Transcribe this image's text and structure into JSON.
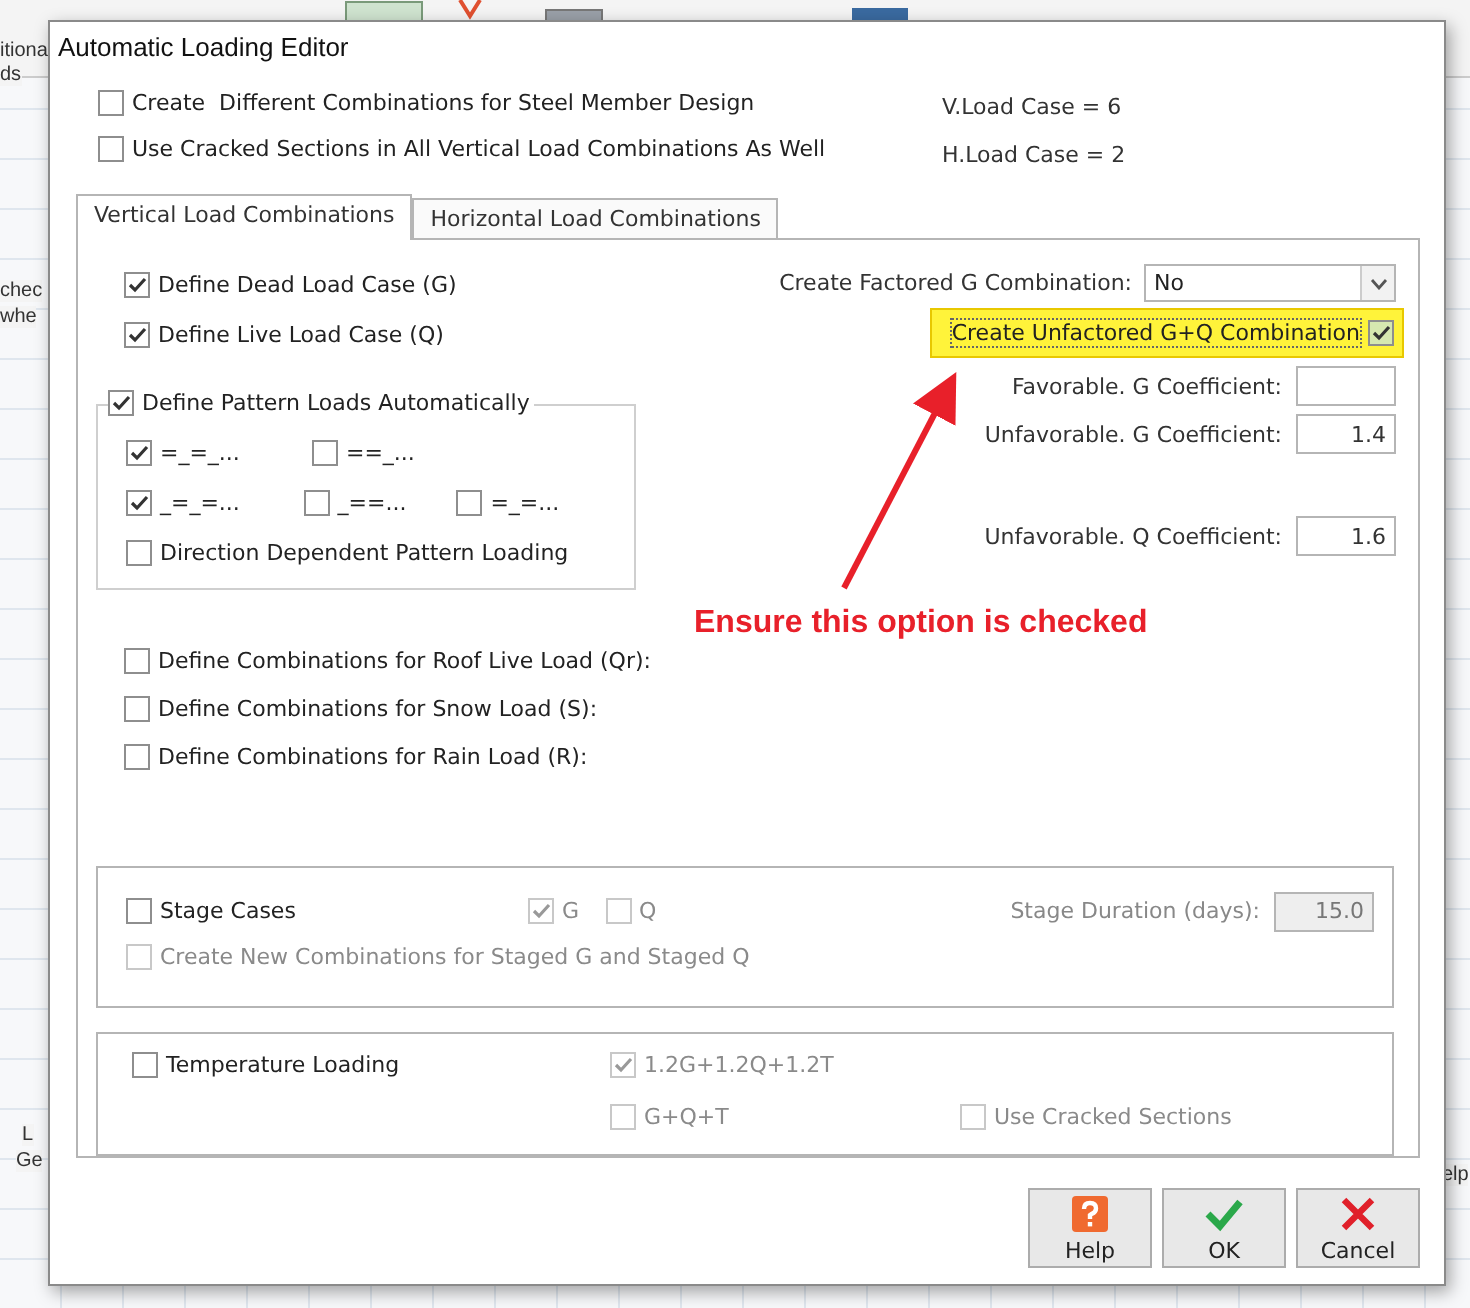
{
  "background": {
    "fragments": [
      "itiona",
      "ds",
      "chec",
      "whe",
      "L",
      "Ge",
      "elp"
    ]
  },
  "window": {
    "title": "Automatic Loading Editor"
  },
  "options": [
    {
      "label": "Create  Different Combinations for Steel Member Design",
      "checked": false
    },
    {
      "label": "Use Cracked Sections in All Vertical Load Combinations As Well",
      "checked": false
    }
  ],
  "load_case_counts": [
    "V.Load Case = 6",
    "H.Load Case = 2"
  ],
  "tabs": [
    {
      "label": "Vertical Load Combinations",
      "selected": true
    },
    {
      "label": "Horizontal Load Combinations",
      "selected": false
    }
  ],
  "vertical": {
    "load_cases": [
      {
        "label": "Define Dead Load Case (G)",
        "checked": true
      },
      {
        "label": "Define Live Load Case (Q)",
        "checked": true
      }
    ],
    "pattern_loads": {
      "label": "Define Pattern Loads Automatically",
      "checked": true,
      "rows": [
        [
          {
            "label": "=_=_...",
            "checked": true
          },
          {
            "label": "==_...",
            "checked": false
          }
        ],
        [
          {
            "label": "_=_=...",
            "checked": true
          },
          {
            "label": "_==...",
            "checked": false
          },
          {
            "label": "=_=...",
            "checked": false
          }
        ]
      ],
      "direction_dependent": {
        "label": "Direction Dependent Pattern Loading",
        "checked": false
      }
    },
    "other_combinations": [
      {
        "label": "Define Combinations for Roof Live Load (Qr):",
        "checked": false
      },
      {
        "label": "Define Combinations for Snow Load (S):",
        "checked": false
      },
      {
        "label": "Define Combinations for Rain Load (R):",
        "checked": false
      }
    ],
    "factored_g": {
      "label": "Create Factored G Combination:",
      "value": "No"
    },
    "unfactored_gq": {
      "label": "Create Unfactored G+Q Combination",
      "checked": true,
      "highlighted": true
    },
    "coefficients": [
      {
        "label": "Favorable. G Coefficient:"
      },
      {
        "label": "Unfavorable. G Coefficient:",
        "value": "1.4"
      },
      {
        "label": "Unfavorable. Q Coefficient:",
        "value": "1.6"
      }
    ]
  },
  "stage_cases": {
    "label": "Stage Cases",
    "checked": false,
    "parts": [
      {
        "label": "G",
        "checked": true,
        "disabled": true
      },
      {
        "label": "Q",
        "checked": false,
        "disabled": true
      }
    ],
    "duration": {
      "label": "Stage Duration (days):",
      "value": "15.0",
      "disabled": true
    },
    "create_new": {
      "label": "Create New Combinations for Staged G and Staged Q",
      "checked": false,
      "disabled": true
    }
  },
  "temperature": {
    "label": "Temperature Loading",
    "checked": false,
    "options": [
      {
        "label": "1.2G+1.2Q+1.2T",
        "checked": true,
        "disabled": true
      },
      {
        "label": "G+Q+T",
        "checked": false,
        "disabled": true
      },
      {
        "label": "Use Cracked Sections",
        "checked": false,
        "disabled": true
      }
    ]
  },
  "annotation": {
    "text": "Ensure this option is checked"
  },
  "buttons": [
    {
      "kind": "help",
      "label": "Help"
    },
    {
      "kind": "ok",
      "label": "OK"
    },
    {
      "kind": "cancel",
      "label": "Cancel"
    }
  ]
}
